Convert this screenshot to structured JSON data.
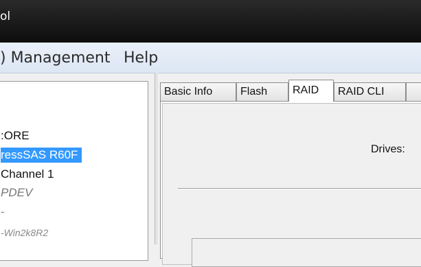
{
  "window": {
    "title": "ol"
  },
  "menubar": {
    "raid_management": ") Management",
    "help": "Help"
  },
  "tree": {
    "core": ":ORE",
    "controller": "ressSAS R60F",
    "channel": "Channel 1",
    "pdev": "PDEV",
    "dot": "-",
    "win": "-Win2k8R2"
  },
  "tabs": [
    "Basic Info",
    "Flash",
    "RAID",
    "RAID CLI",
    ""
  ],
  "selected_tab": "RAID",
  "raid_tab": {
    "drives_label": "Drives:"
  },
  "colors": {
    "selection": "#3399ff",
    "titlebar": "#0d0d0d",
    "menubar": "#dce6f4"
  }
}
